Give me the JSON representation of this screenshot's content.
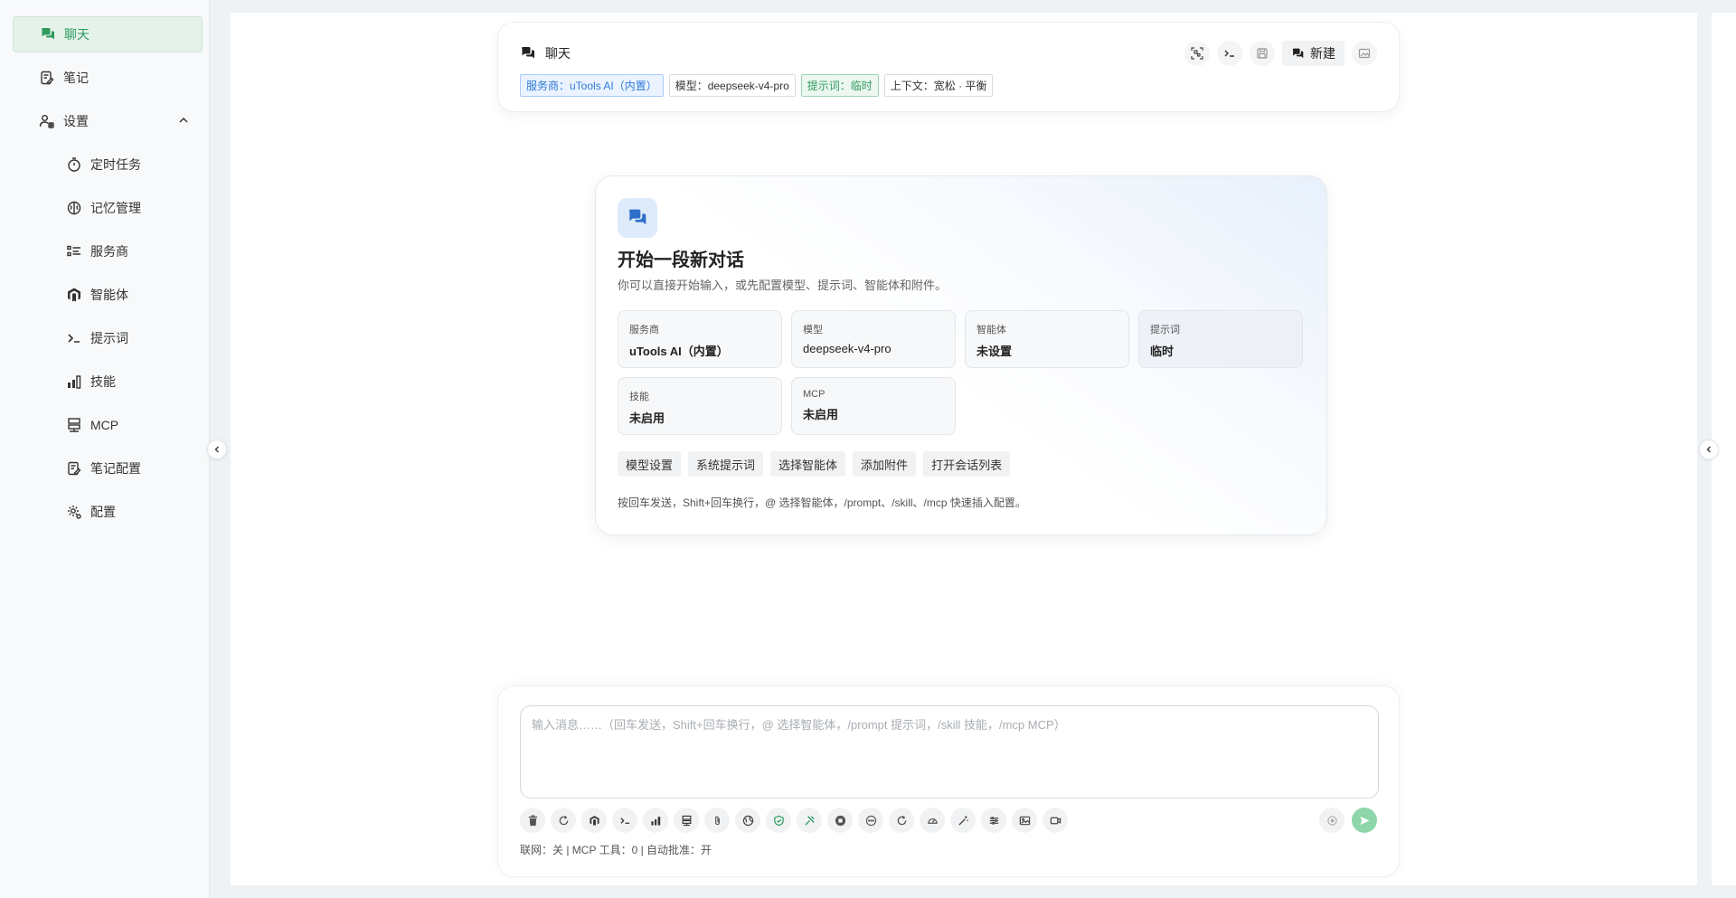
{
  "sidebar": {
    "items": [
      {
        "label": "聊天",
        "icon": "chat-icon",
        "active": true
      },
      {
        "label": "笔记",
        "icon": "note-icon"
      },
      {
        "label": "设置",
        "icon": "users-gear-icon",
        "expanded": true
      },
      {
        "label": "定时任务",
        "icon": "timer-icon"
      },
      {
        "label": "记忆管理",
        "icon": "brain-icon"
      },
      {
        "label": "服务商",
        "icon": "list-icon"
      },
      {
        "label": "智能体",
        "icon": "agent-logo-icon"
      },
      {
        "label": "提示词",
        "icon": "terminal-icon"
      },
      {
        "label": "技能",
        "icon": "bars-chart-icon"
      },
      {
        "label": "MCP",
        "icon": "server-icon"
      },
      {
        "label": "笔记配置",
        "icon": "note-settings-icon"
      },
      {
        "label": "配置",
        "icon": "gear-icon"
      }
    ]
  },
  "header": {
    "title": "聊天",
    "tags": {
      "provider": "服务商：uTools AI（内置）",
      "model": "模型：deepseek-v4-pro",
      "prompt": "提示词：临时",
      "context": "上下文：宽松 · 平衡"
    },
    "new_label": "新建"
  },
  "welcome": {
    "title": "开始一段新对话",
    "subtitle": "你可以直接开始输入，或先配置模型、提示词、智能体和附件。",
    "cards": {
      "provider": {
        "label": "服务商",
        "value": "uTools AI（内置）"
      },
      "model": {
        "label": "模型",
        "value": "deepseek-v4-pro"
      },
      "agent": {
        "label": "智能体",
        "value": "未设置"
      },
      "prompt": {
        "label": "提示词",
        "value": "临时"
      },
      "skill": {
        "label": "技能",
        "value": "未启用"
      },
      "mcp": {
        "label": "MCP",
        "value": "未启用"
      }
    },
    "actions": {
      "model_settings": "模型设置",
      "system_prompt": "系统提示词",
      "select_agent": "选择智能体",
      "add_attachment": "添加附件",
      "open_list": "打开会话列表"
    },
    "hint": "按回车发送，Shift+回车换行，@ 选择智能体，/prompt、/skill、/mcp 快速插入配置。"
  },
  "input": {
    "placeholder": "输入消息……（回车发送，Shift+回车换行，@ 选择智能体，/prompt 提示词，/skill 技能，/mcp MCP）",
    "status": "联网：关 | MCP 工具：0 | 自动批准：开"
  },
  "colors": {
    "accent": "#2e9a5e",
    "send": "#8fd6aa",
    "tag_blue": "#2f7ad6"
  }
}
